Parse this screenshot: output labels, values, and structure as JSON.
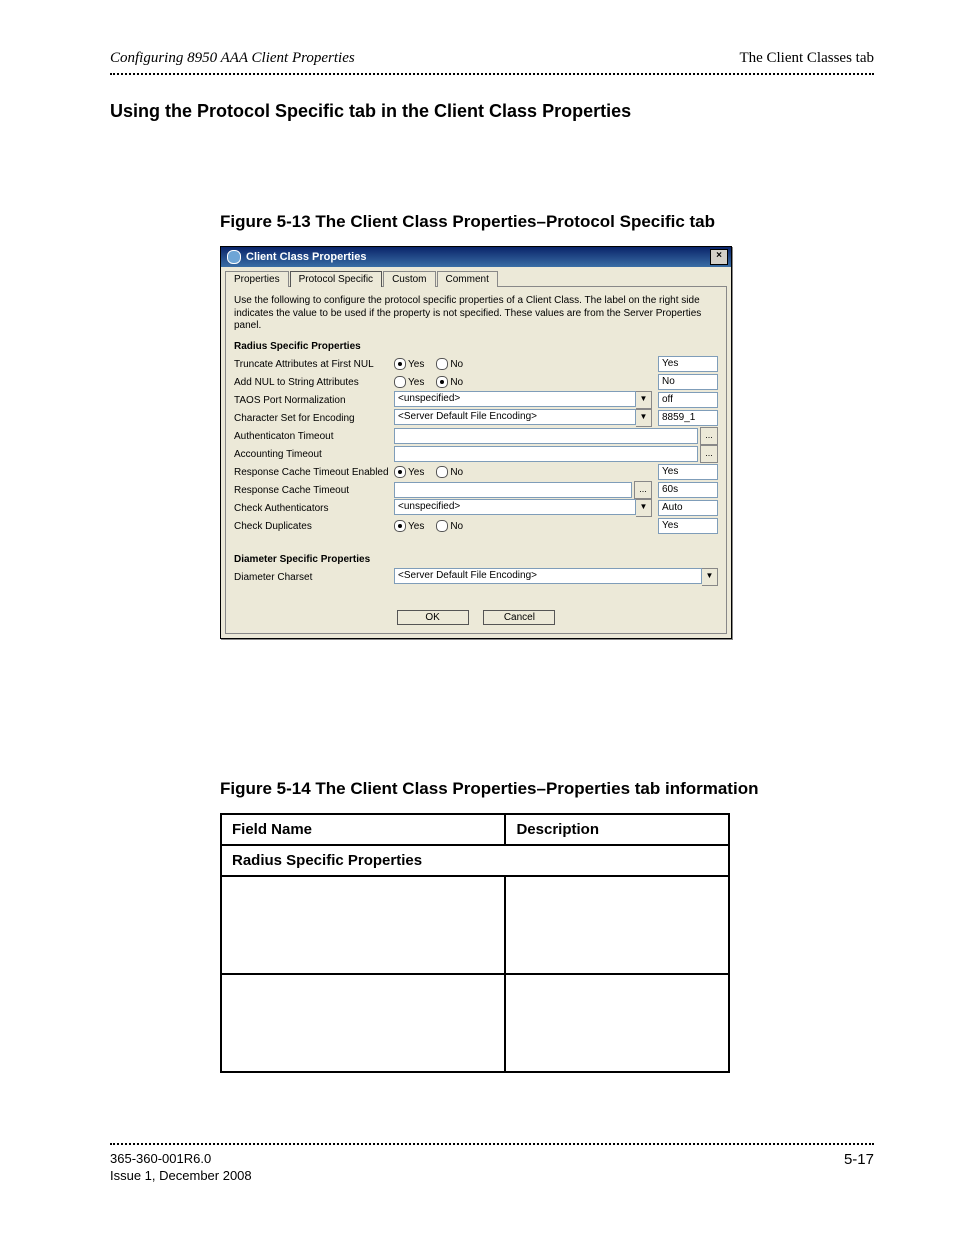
{
  "running_head": {
    "left": "Configuring 8950 AAA Client Properties",
    "right": "The Client Classes tab"
  },
  "heading": "Using the Protocol Specific tab in the Client Class Properties",
  "figure513_caption": "Figure 5-13   The Client Class Properties–Protocol Specific tab",
  "figure514_caption": "Figure 5-14   The Client Class Properties–Properties tab information",
  "dialog": {
    "title": "Client Class Properties",
    "close_glyph": "×",
    "tabs": {
      "t0": "Properties",
      "t1": "Protocol Specific",
      "t2": "Custom",
      "t3": "Comment"
    },
    "instr": "Use the following to configure the protocol specific properties of a Client Class. The label on the right side indicates the value to be used if the property is not specified. These values are from the Server Properties panel.",
    "radius_section": "Radius Specific Properties",
    "yes": "Yes",
    "no": "No",
    "rows": {
      "truncate": {
        "label": "Truncate Attributes at First NUL",
        "default": "Yes"
      },
      "addnul": {
        "label": "Add NUL to String Attributes",
        "default": "No"
      },
      "taos": {
        "label": "TAOS Port Normalization",
        "value": "<unspecified>",
        "default": "off"
      },
      "charset": {
        "label": "Character Set for Encoding",
        "value": "<Server Default File Encoding>",
        "default": "8859_1"
      },
      "authto": {
        "label": "Authenticaton Timeout",
        "value": ""
      },
      "acctto": {
        "label": "Accounting Timeout",
        "value": ""
      },
      "rce": {
        "label": "Response Cache Timeout Enabled",
        "default": "Yes"
      },
      "rct": {
        "label": "Response Cache Timeout",
        "value": "",
        "default": "60s"
      },
      "chkauth": {
        "label": "Check Authenticators",
        "value": "<unspecified>",
        "default": "Auto"
      },
      "chkdup": {
        "label": "Check Duplicates",
        "default": "Yes"
      }
    },
    "diameter_section": "Diameter Specific Properties",
    "diam_charset": {
      "label": "Diameter Charset",
      "value": "<Server Default File Encoding>"
    },
    "ok": "OK",
    "cancel": "Cancel",
    "ellipsis": "...",
    "combo_arrow": "▼"
  },
  "table": {
    "head_field": "Field Name",
    "head_desc": "Description",
    "radius_row": "Radius Specific Properties"
  },
  "footer": {
    "doc_id": "365-360-001R6.0",
    "issue": "Issue 1,   December 2008",
    "page": "5-17"
  }
}
